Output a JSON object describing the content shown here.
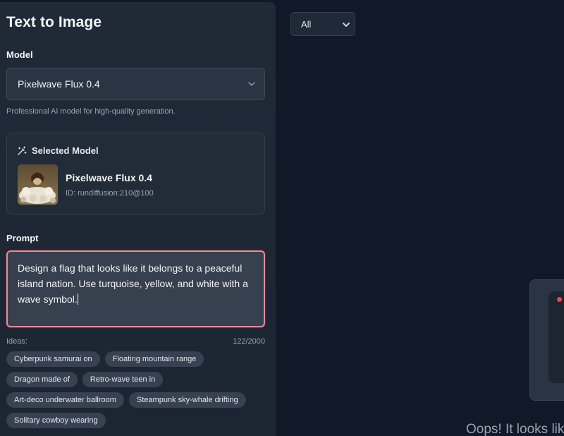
{
  "left_panel": {
    "title": "Text to Image",
    "model_label": "Model",
    "model_select_value": "Pixelwave Flux 0.4",
    "model_description": "Professional AI model for high-quality generation.",
    "selected_model": {
      "heading": "Selected Model",
      "name": "Pixelwave Flux 0.4",
      "id": "ID: rundiffusion:210@100"
    },
    "prompt_label": "Prompt",
    "prompt_value": "Design a flag that looks like it belongs to a peaceful island nation. Use turquoise, yellow, and white with a wave symbol.",
    "ideas_label": "Ideas:",
    "char_count": "122/2000",
    "ideas": [
      "Cyberpunk samurai on",
      "Floating mountain range",
      "Dragon made of",
      "Retro-wave teen in",
      "Art-deco underwater ballroom",
      "Steampunk sky-whale drifting",
      "Solitary cowboy wearing"
    ]
  },
  "right_area": {
    "filter_value": "All",
    "error_text": "Oops! It looks like"
  },
  "colors": {
    "background": "#111827",
    "panel": "#202a37",
    "prompt_focus_border": "#e88a9a",
    "status_dot": "#ef4444"
  },
  "icons": {
    "selected_model": "magic-wand-icon",
    "dropdown": "chevron-down-icon"
  }
}
